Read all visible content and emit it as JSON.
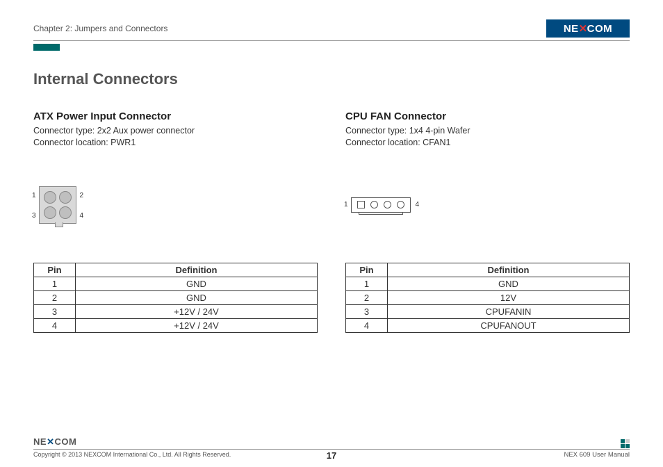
{
  "header": {
    "chapter": "Chapter 2: Jumpers and Connectors",
    "logo_text": "NEXCOM"
  },
  "main": {
    "title": "Internal Connectors",
    "left": {
      "heading": "ATX Power Input Connector",
      "type_line": "Connector type: 2x2 Aux power connector",
      "location_line": "Connector location: PWR1",
      "pin_labels": {
        "p1": "1",
        "p2": "2",
        "p3": "3",
        "p4": "4"
      },
      "table": {
        "col_pin": "Pin",
        "col_def": "Definition",
        "rows": [
          {
            "pin": "1",
            "def": "GND"
          },
          {
            "pin": "2",
            "def": "GND"
          },
          {
            "pin": "3",
            "def": "+12V / 24V"
          },
          {
            "pin": "4",
            "def": "+12V / 24V"
          }
        ]
      }
    },
    "right": {
      "heading": "CPU FAN Connector",
      "type_line": "Connector type: 1x4 4-pin Wafer",
      "location_line": "Connector location: CFAN1",
      "pin_labels": {
        "p1": "1",
        "p4": "4"
      },
      "table": {
        "col_pin": "Pin",
        "col_def": "Definition",
        "rows": [
          {
            "pin": "1",
            "def": "GND"
          },
          {
            "pin": "2",
            "def": "12V"
          },
          {
            "pin": "3",
            "def": "CPUFANIN"
          },
          {
            "pin": "4",
            "def": "CPUFANOUT"
          }
        ]
      }
    }
  },
  "footer": {
    "logo_small": "NEXCOM",
    "copyright": "Copyright © 2013 NEXCOM International Co., Ltd. All Rights Reserved.",
    "page": "17",
    "manual": "NEX 609 User Manual"
  }
}
